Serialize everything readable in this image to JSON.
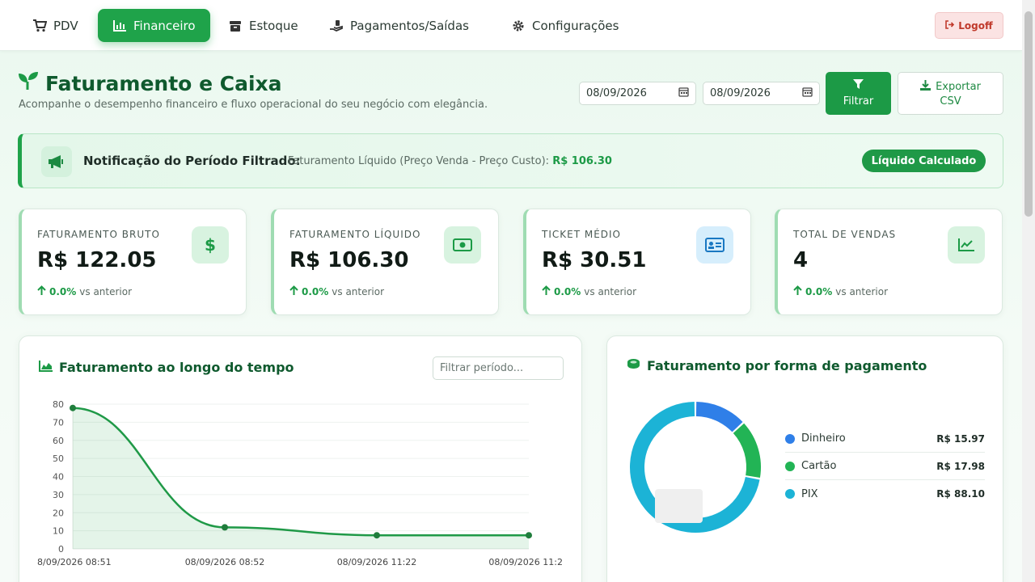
{
  "nav": {
    "items": [
      {
        "label": "PDV",
        "icon": "cart-icon"
      },
      {
        "label": "Financeiro",
        "icon": "chart-icon",
        "active": true
      },
      {
        "label": "Estoque",
        "icon": "box-icon"
      },
      {
        "label": "Pagamentos/Saídas",
        "icon": "hand-money-icon"
      },
      {
        "label": "Configurações",
        "icon": "gear-icon"
      }
    ],
    "logoff": "Logoff"
  },
  "header": {
    "title": "Faturamento e Caixa",
    "subtitle": "Acompanhe o desempenho financeiro e fluxo operacional do seu negócio com elegância.",
    "date_from": "08/09/2026",
    "date_to": "08/09/2026",
    "filter_label": "Filtrar",
    "export_label_1": "Exportar",
    "export_label_2": "CSV"
  },
  "notification": {
    "title": "Notificação do Período Filtrado:",
    "text": "Faturamento Líquido (Preço Venda - Preço Custo):",
    "value": "R$ 106.30",
    "badge": "Líquido Calculado"
  },
  "kpis": [
    {
      "label": "FATURAMENTO BRUTO",
      "value": "R$ 122.05",
      "delta": "0.0%",
      "delta_text": "vs anterior",
      "icon": "dollar-icon"
    },
    {
      "label": "FATURAMENTO LÍQUIDO",
      "value": "R$ 106.30",
      "delta": "0.0%",
      "delta_text": "vs anterior",
      "icon": "money-bill-icon"
    },
    {
      "label": "TICKET MÉDIO",
      "value": "R$ 30.51",
      "delta": "0.0%",
      "delta_text": "vs anterior",
      "icon": "id-card-icon"
    },
    {
      "label": "TOTAL DE VENDAS",
      "value": "4",
      "delta": "0.0%",
      "delta_text": "vs anterior",
      "icon": "trend-icon"
    }
  ],
  "line_panel": {
    "title": "Faturamento ao longo do tempo",
    "period_placeholder": "Filtrar período..."
  },
  "pie_panel": {
    "title": "Faturamento por forma de pagamento"
  },
  "colors": {
    "primary": "#1fa34a",
    "dinheiro": "#2f7fe8",
    "cartao": "#22b455",
    "pix": "#1cb3d6"
  },
  "chart_data": [
    {
      "type": "line",
      "x": [
        "8/09/2026 08:51",
        "08/09/2026 08:52",
        "08/09/2026 11:22",
        "08/09/2026 11:2"
      ],
      "series": [
        {
          "values": [
            77.9,
            11.9,
            7.5,
            7.5
          ]
        }
      ],
      "ylim": [
        0,
        80
      ],
      "yticks": [
        0,
        10,
        20,
        30,
        40,
        50,
        60,
        70,
        80
      ],
      "grid": true
    },
    {
      "type": "pie",
      "categories": [
        "Dinheiro",
        "Cartão",
        "PIX"
      ],
      "values": [
        15.97,
        17.98,
        88.1
      ],
      "value_labels": [
        "R$ 15.97",
        "R$ 17.98",
        "R$ 88.10"
      ],
      "legend": "right"
    }
  ]
}
